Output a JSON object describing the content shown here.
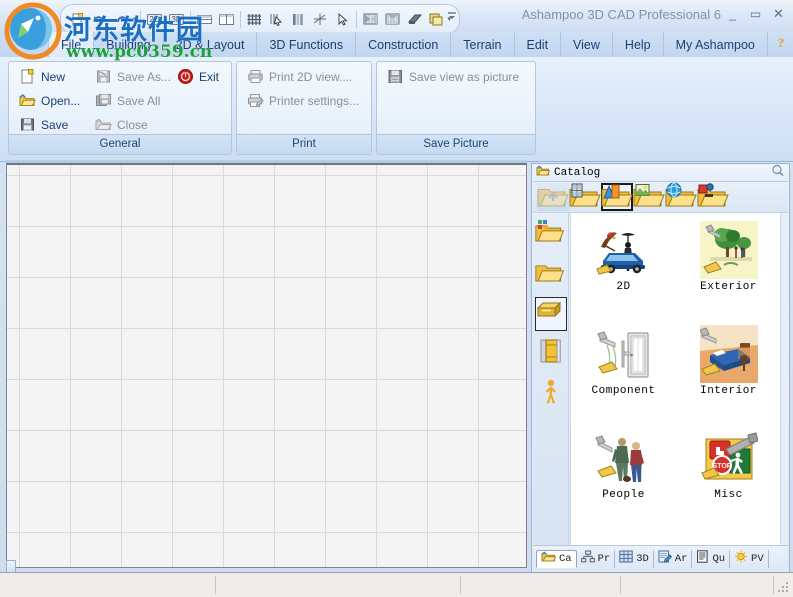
{
  "window": {
    "title": "Ashampoo 3D CAD Professional 6",
    "minimize": "_",
    "maximize": "▭",
    "close": "✕"
  },
  "quick_access": {
    "buttons": [
      {
        "name": "new-doc-icon",
        "tip": "New"
      },
      {
        "name": "undo-icon",
        "tip": "Undo"
      },
      {
        "name": "redo-icon",
        "tip": "Redo"
      },
      {
        "name": "view-2d-icon",
        "tip": "2D"
      },
      {
        "name": "view-3d-icon",
        "tip": "3D"
      },
      {
        "name": "split-horizontal-icon",
        "tip": "Split horizontal"
      },
      {
        "name": "split-vertical-icon",
        "tip": "Split vertical"
      },
      {
        "name": "grid-icon",
        "tip": "Grid"
      },
      {
        "name": "snap-icon",
        "tip": "Snap"
      },
      {
        "name": "columns-icon",
        "tip": "Columns"
      },
      {
        "name": "crosshair-icon",
        "tip": "Crosshair"
      },
      {
        "name": "pointer-icon",
        "tip": "Select"
      },
      {
        "name": "roof-left-icon",
        "tip": "Roof left"
      },
      {
        "name": "roof-right-icon",
        "tip": "Roof right"
      },
      {
        "name": "slab-icon",
        "tip": "Slab"
      },
      {
        "name": "layers-icon",
        "tip": "Layers"
      }
    ],
    "dropdown_arrow": "▾",
    "overflow": "≡"
  },
  "menubar": {
    "items": [
      {
        "label": "File",
        "active": true
      },
      {
        "label": "Building",
        "active": false
      },
      {
        "label": "2D & Layout",
        "active": false
      },
      {
        "label": "3D Functions",
        "active": false
      },
      {
        "label": "Construction",
        "active": false
      },
      {
        "label": "Terrain",
        "active": false
      },
      {
        "label": "Edit",
        "active": false
      },
      {
        "label": "View",
        "active": false
      },
      {
        "label": "Help",
        "active": false
      },
      {
        "label": "My Ashampoo",
        "active": false
      }
    ],
    "help_icon": "help-question-icon",
    "help_arrow": "▾"
  },
  "ribbon": {
    "groups": [
      {
        "caption": "General",
        "items": [
          {
            "label": "New",
            "icon": "new-document-icon",
            "enabled": true,
            "col": 0,
            "row": 0
          },
          {
            "label": "Open...",
            "icon": "open-folder-icon",
            "enabled": true,
            "col": 0,
            "row": 1
          },
          {
            "label": "Save",
            "icon": "floppy-save-icon",
            "enabled": true,
            "col": 0,
            "row": 2
          },
          {
            "label": "Save As...",
            "icon": "save-as-icon",
            "enabled": false,
            "col": 1,
            "row": 0
          },
          {
            "label": "Save All",
            "icon": "save-all-icon",
            "enabled": false,
            "col": 1,
            "row": 1
          },
          {
            "label": "Close",
            "icon": "close-folder-icon",
            "enabled": false,
            "col": 1,
            "row": 2
          },
          {
            "label": "Exit",
            "icon": "exit-power-icon",
            "enabled": true,
            "col": 2,
            "row": 0
          }
        ]
      },
      {
        "caption": "Print",
        "items": [
          {
            "label": "Print 2D view....",
            "icon": "printer-icon",
            "enabled": false,
            "col": 0,
            "row": 0
          },
          {
            "label": "Printer settings...",
            "icon": "printer-settings-icon",
            "enabled": false,
            "col": 0,
            "row": 1
          }
        ]
      },
      {
        "caption": "Save Picture",
        "items": [
          {
            "label": "Save view as picture",
            "icon": "save-picture-icon",
            "enabled": false,
            "col": 0,
            "row": 0
          }
        ]
      }
    ]
  },
  "catalog": {
    "title": "Catalog",
    "title_icon": "open-folder-icon",
    "search_icon": "magnifier-icon",
    "toolbar": [
      {
        "name": "catalog-up-icon",
        "selected": false,
        "enabled": false
      },
      {
        "name": "catalog-building-icon",
        "selected": false,
        "enabled": true
      },
      {
        "name": "catalog-objects-icon",
        "selected": true,
        "enabled": true
      },
      {
        "name": "catalog-textures-icon",
        "selected": false,
        "enabled": true
      },
      {
        "name": "catalog-world-icon",
        "selected": false,
        "enabled": true
      },
      {
        "name": "catalog-favorites-icon",
        "selected": false,
        "enabled": true
      }
    ],
    "side_buttons": [
      {
        "name": "side-recent-icon",
        "selected": false
      },
      {
        "name": "side-folder-icon",
        "selected": false
      },
      {
        "name": "side-catalog-icon",
        "selected": true
      },
      {
        "name": "side-library-icon",
        "selected": false
      },
      {
        "name": "side-people-icon",
        "selected": false
      }
    ],
    "items": [
      {
        "label": "2D",
        "thumb": "thumb-2d"
      },
      {
        "label": "Exterior",
        "thumb": "thumb-exterior"
      },
      {
        "label": "Component",
        "thumb": "thumb-component"
      },
      {
        "label": "Interior",
        "thumb": "thumb-interior"
      },
      {
        "label": "People",
        "thumb": "thumb-people"
      },
      {
        "label": "Misc",
        "thumb": "thumb-misc"
      }
    ],
    "tabs": [
      {
        "label": "Ca",
        "icon": "tab-catalog-icon",
        "active": true
      },
      {
        "label": "Pr",
        "icon": "tab-project-icon",
        "active": false
      },
      {
        "label": "3D",
        "icon": "tab-3d-icon",
        "active": false
      },
      {
        "label": "Ar",
        "icon": "tab-article-icon",
        "active": false
      },
      {
        "label": "Qu",
        "icon": "tab-quantity-icon",
        "active": false
      },
      {
        "label": "PV",
        "icon": "tab-pv-icon",
        "active": false
      }
    ]
  },
  "watermark": {
    "site_name_cn": "河东软件园",
    "site_url": "www.pc0359.cn"
  },
  "colors": {
    "accent_blue": "#1c3f73",
    "title_gray": "#7f93ad",
    "ribbon_bg": "#dceaf9",
    "folder_yellow": "#f5c842",
    "watermark_blue": "#1a6fc4",
    "watermark_green": "#1f9e3f",
    "canvas_grid": "#d9d9d9",
    "statusbar_bg": "#f1ecec"
  }
}
